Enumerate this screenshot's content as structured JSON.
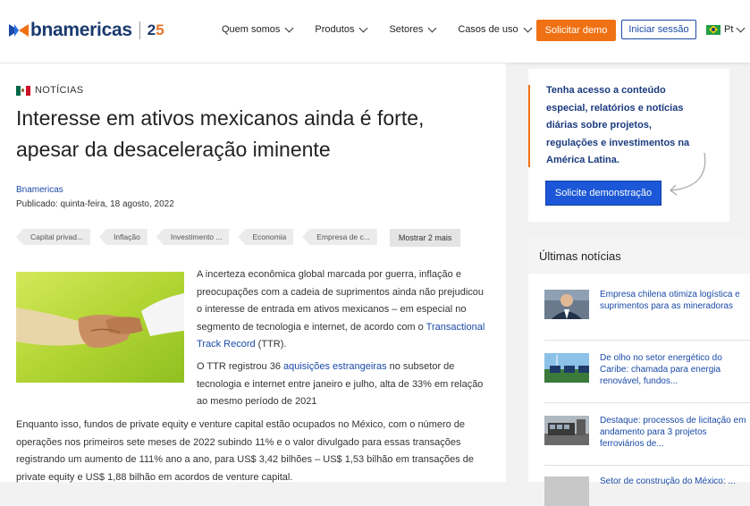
{
  "header": {
    "logo_text": "bnamericas",
    "logo_25_a": "2",
    "logo_25_b": "5",
    "nav": [
      {
        "label": "Quem somos"
      },
      {
        "label": "Produtos"
      },
      {
        "label": "Setores"
      },
      {
        "label": "Casos de uso"
      }
    ],
    "demo_button": "Solicitar demo",
    "login_button": "Iniciar sessão",
    "language": "Pt"
  },
  "article": {
    "category": "NOTÍCIAS",
    "title": "Interesse em ativos mexicanos ainda é forte, apesar da desaceleração iminente",
    "author": "Bnamericas",
    "published": "Publicado: quinta-feira, 18 agosto, 2022",
    "tags": [
      "Capital privad...",
      "Inflação",
      "Investimento ...",
      "Economia",
      "Empresa de c..."
    ],
    "tags_more": "Mostrar 2 mais",
    "para1_a": "A incerteza econômica global marcada por guerra, inflação e preocupações com a cadeia de suprimentos ainda não prejudicou o interesse de entrada em ativos mexicanos – em especial no segmento de tecnologia e internet, de acordo com o ",
    "para1_link": "Transactional Track Record",
    "para1_b": " (TTR).",
    "para2_a": "O TTR registrou 36 ",
    "para2_link": "aquisições estrangeiras",
    "para2_b": " no subsetor de tecnologia e internet entre janeiro e julho, alta de 33% em relação ao mesmo período de 2021",
    "para3": "Enquanto isso, fundos de private equity e venture capital estão ocupados no México, com o número de operações nos primeiros sete meses de 2022 subindo 11% e o valor divulgado para essas transações registrando um aumento de 111% ano a ano, para US$ 3,42 bilhões – US$ 1,53 bilhão em transações de private equity e US$ 1,88 bilhão em acordos de venture capital."
  },
  "sidebar": {
    "cta_text": "Tenha acesso a conteúdo especial, relatórios e notícias diárias sobre projetos, regulações e investimentos na América Latina.",
    "cta_button": "Solicite demonstração",
    "news_title": "Últimas notícias",
    "news": [
      {
        "text": "Empresa chilena otimiza logística e suprimentos para as mineradoras"
      },
      {
        "text": "De olho no setor energético do Caribe: chamada para energia renovável, fundos..."
      },
      {
        "text": "Destaque: processos de licitação em andamento para 3 projetos ferroviários de..."
      },
      {
        "text": "Setor de construção do México: ..."
      }
    ]
  },
  "colors": {
    "brand_blue": "#1a3a6e",
    "accent_orange": "#f07114",
    "link_blue": "#1a4aa8"
  }
}
